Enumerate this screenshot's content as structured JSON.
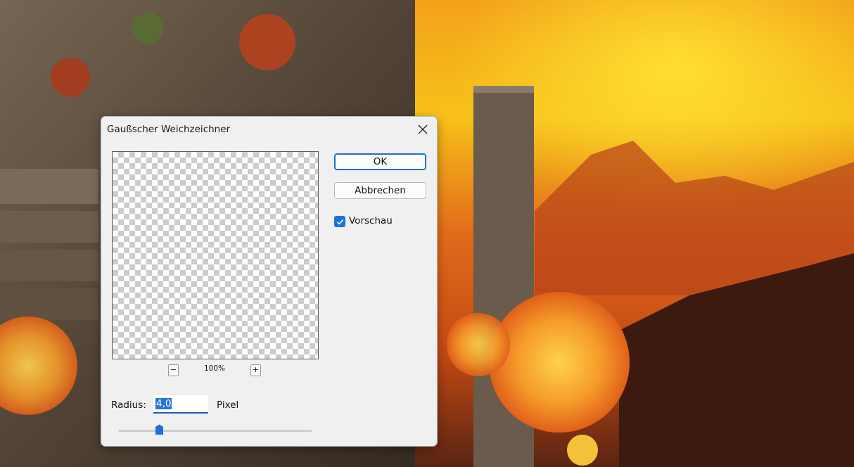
{
  "dialog": {
    "title": "Gaußscher Weichzeichner",
    "ok_label": "OK",
    "cancel_label": "Abbrechen",
    "preview_label": "Vorschau",
    "preview_checked": true,
    "zoom_minus": "−",
    "zoom_plus": "+",
    "zoom_level": "100%",
    "radius_label": "Radius:",
    "radius_value": "4,0",
    "radius_unit": "Pixel",
    "radius_slider_fraction": 0.2
  },
  "icons": {
    "close": "close-icon",
    "checkmark": "checkmark-icon",
    "slider_thumb": "slider-thumb-icon"
  },
  "colors": {
    "accent": "#1f6fd6",
    "dialog_bg": "#f0f0f0"
  }
}
